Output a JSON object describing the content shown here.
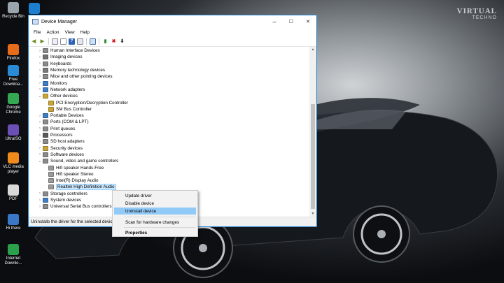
{
  "desktop": {
    "watermark_big": "VIRTUAL",
    "watermark_small": "TECHNO",
    "icons": [
      {
        "label": "Recycle Bin",
        "color": "#9aa4ad"
      },
      {
        "label": "",
        "color": "#1e7fd0"
      },
      {
        "label": "Firefox",
        "color": "#e66b1a"
      },
      {
        "label": "Free Downloa...",
        "color": "#2a8ad6"
      },
      {
        "label": "Google Chrome",
        "color": "#34a853"
      },
      {
        "label": "UltraISO",
        "color": "#6a4fb4"
      },
      {
        "label": "VLC media player",
        "color": "#f08a1c"
      },
      {
        "label": "PDF",
        "color": "#d9d9d9"
      },
      {
        "label": "Hi there",
        "color": "#3b77c7"
      },
      {
        "label": "Internet Downlo...",
        "color": "#2aa14a"
      }
    ]
  },
  "window": {
    "title": "Device Manager",
    "menu": [
      "File",
      "Action",
      "View",
      "Help"
    ],
    "buttons": {
      "minimize": "–",
      "maximize": "☐",
      "close": "✕"
    },
    "status": "Uninstalls the driver for the selected devic"
  },
  "tree": [
    {
      "label": "Human Interface Devices",
      "level": 1,
      "arrow": "›",
      "color": "#8a8a8a"
    },
    {
      "label": "Imaging devices",
      "level": 1,
      "arrow": "›",
      "color": "#707070"
    },
    {
      "label": "Keyboards",
      "level": 1,
      "arrow": "›",
      "color": "#8a8a8a"
    },
    {
      "label": "Memory technology devices",
      "level": 1,
      "arrow": "›",
      "color": "#7a7a7a"
    },
    {
      "label": "Mice and other pointing devices",
      "level": 1,
      "arrow": "›",
      "color": "#8a8a8a"
    },
    {
      "label": "Monitors",
      "level": 1,
      "arrow": "›",
      "color": "#3d7fc6"
    },
    {
      "label": "Network adapters",
      "level": 1,
      "arrow": "›",
      "color": "#3d7fc6"
    },
    {
      "label": "Other devices",
      "level": 1,
      "arrow": "⌄",
      "color": "#c9a437"
    },
    {
      "label": "PCI Encryption/Decryption Controller",
      "level": 2,
      "arrow": "",
      "color": "#c9a437"
    },
    {
      "label": "SM Bus Controller",
      "level": 2,
      "arrow": "",
      "color": "#c9a437"
    },
    {
      "label": "Portable Devices",
      "level": 1,
      "arrow": "›",
      "color": "#3d7fc6"
    },
    {
      "label": "Ports (COM & LPT)",
      "level": 1,
      "arrow": "›",
      "color": "#8a8a8a"
    },
    {
      "label": "Print queues",
      "level": 1,
      "arrow": "›",
      "color": "#8a8a8a"
    },
    {
      "label": "Processors",
      "level": 1,
      "arrow": "›",
      "color": "#5a5a5a"
    },
    {
      "label": "SD host adapters",
      "level": 1,
      "arrow": "›",
      "color": "#8a8a8a"
    },
    {
      "label": "Security devices",
      "level": 1,
      "arrow": "›",
      "color": "#c9a437"
    },
    {
      "label": "Software devices",
      "level": 1,
      "arrow": "›",
      "color": "#8a8a8a"
    },
    {
      "label": "Sound, video and game controllers",
      "level": 1,
      "arrow": "⌄",
      "color": "#8a8a8a"
    },
    {
      "label": "Hifi speaker Hands-Free",
      "level": 2,
      "arrow": "",
      "color": "#9a9a9a"
    },
    {
      "label": "Hifi speaker Stereo",
      "level": 2,
      "arrow": "",
      "color": "#9a9a9a"
    },
    {
      "label": "Intel(R) Display Audio",
      "level": 2,
      "arrow": "",
      "color": "#9a9a9a"
    },
    {
      "label": "Realtek High Definition Audio",
      "level": 2,
      "arrow": "",
      "color": "#9a9a9a",
      "selected": true
    },
    {
      "label": "Storage controllers",
      "level": 1,
      "arrow": "›",
      "color": "#8a8a8a"
    },
    {
      "label": "System devices",
      "level": 1,
      "arrow": "›",
      "color": "#3d7fc6"
    },
    {
      "label": "Universal Serial Bus controllers",
      "level": 1,
      "arrow": "›",
      "color": "#8a8a8a"
    }
  ],
  "context_menu": {
    "update": "Update driver",
    "disable": "Disable device",
    "uninstall": "Uninstall device",
    "scan": "Scan for hardware changes",
    "properties": "Properties"
  },
  "colors": {
    "accent": "#1d80d1",
    "highlight": "#91c9f7",
    "selection": "#cce8ff"
  }
}
